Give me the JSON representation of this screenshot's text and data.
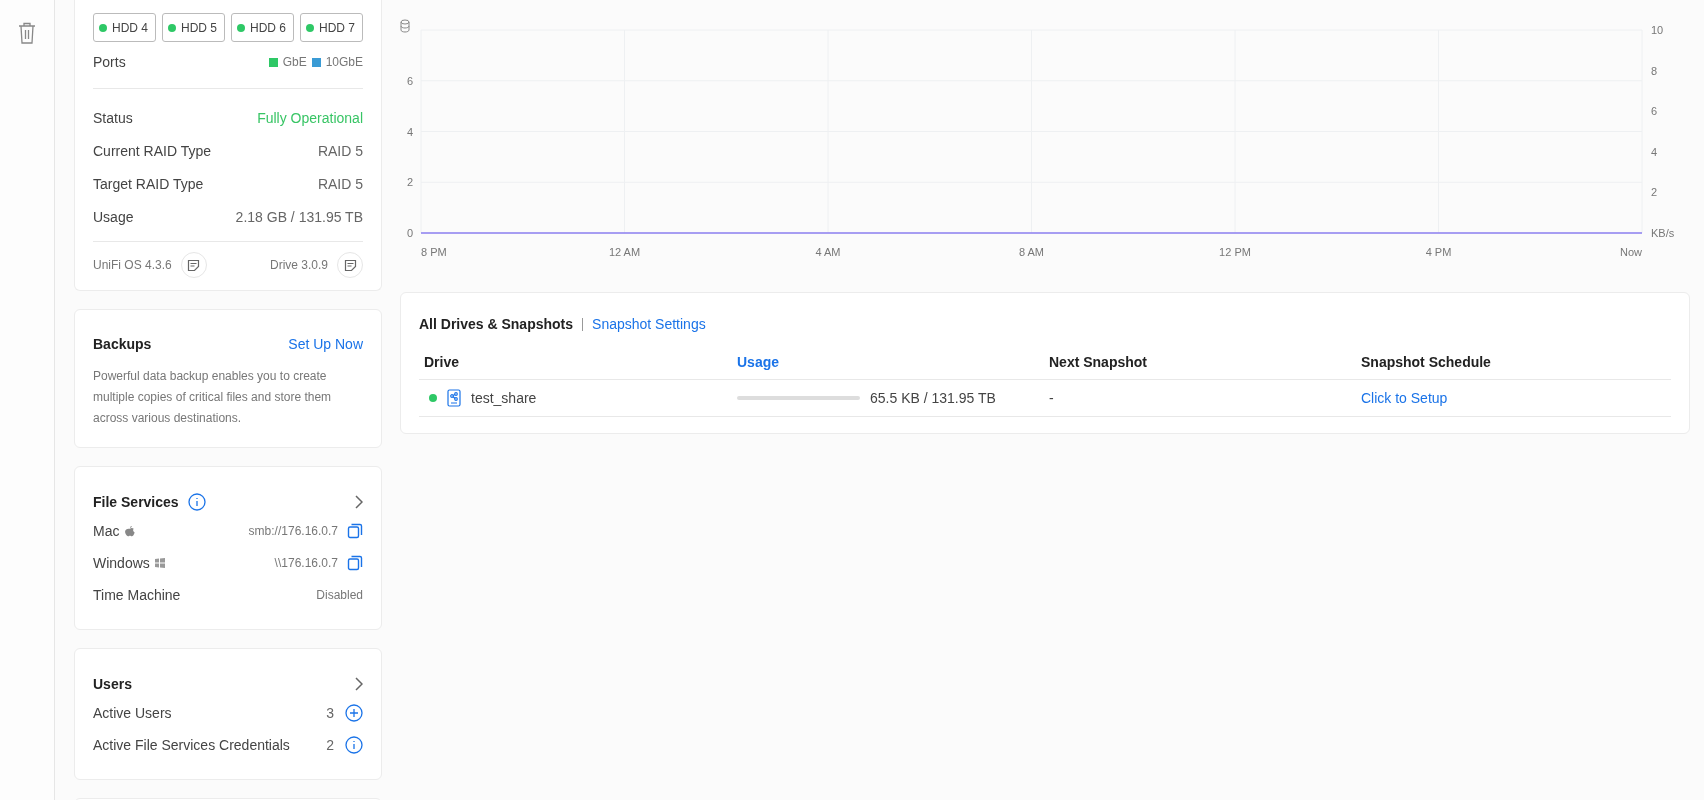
{
  "disks": [
    {
      "label": "HDD 4",
      "healthy": true
    },
    {
      "label": "HDD 5",
      "healthy": true
    },
    {
      "label": "HDD 6",
      "healthy": true
    },
    {
      "label": "HDD 7",
      "healthy": true
    }
  ],
  "ports": {
    "label": "Ports",
    "legend": [
      {
        "label": "GbE",
        "color": "#2ec866"
      },
      {
        "label": "10GbE",
        "color": "#3a9bd5"
      }
    ]
  },
  "details": [
    {
      "label": "Status",
      "value": "Fully Operational",
      "kind": "ok"
    },
    {
      "label": "Current RAID Type",
      "value": "RAID 5",
      "kind": "plain"
    },
    {
      "label": "Target RAID Type",
      "value": "RAID 5",
      "kind": "plain"
    },
    {
      "label": "Usage",
      "value": "2.18 GB / 131.95 TB",
      "kind": "plain"
    }
  ],
  "versions": [
    "UniFi OS 4.3.6",
    "Drive 3.0.9"
  ],
  "backups": {
    "title": "Backups",
    "action": "Set Up Now",
    "description": "Powerful data backup enables you to create multiple copies of critical files and store them across various destinations."
  },
  "file_services": {
    "title": "File Services",
    "rows": [
      {
        "label": "Mac",
        "kind": "mac",
        "value": "smb://176.16.0.7"
      },
      {
        "label": "Windows",
        "kind": "windows",
        "value": "\\\\176.16.0.7"
      },
      {
        "label": "Time Machine",
        "kind": "plain",
        "value": "Disabled"
      }
    ]
  },
  "users": {
    "title": "Users",
    "rows": [
      {
        "label": "Active Users",
        "value": "3",
        "kind": "add"
      },
      {
        "label": "Active File Services Credentials",
        "value": "2",
        "kind": "info"
      }
    ]
  },
  "chart_data": {
    "type": "line",
    "x": [
      "8 PM",
      "12 AM",
      "4 AM",
      "8 AM",
      "12 PM",
      "4 PM",
      "Now"
    ],
    "series": [
      {
        "color": "#8c7ff0",
        "values": [
          0,
          0,
          0,
          0,
          0,
          0,
          0
        ]
      }
    ],
    "ylim": [
      0,
      8
    ],
    "yticks": [
      0,
      2,
      4,
      6
    ],
    "grid": true
  },
  "right_axis": {
    "ticks": [
      "10",
      "8",
      "6",
      "4",
      "2"
    ],
    "unit": "KB/s"
  },
  "drives": {
    "tabs": [
      {
        "label": "All Drives & Snapshots",
        "selected": true
      },
      {
        "label": "Snapshot Settings",
        "selected": false
      }
    ],
    "columns": [
      {
        "label": "Drive",
        "sortable": false
      },
      {
        "label": "Usage",
        "sortable": true
      },
      {
        "label": "Next Snapshot",
        "sortable": false
      },
      {
        "label": "Snapshot Schedule",
        "sortable": false
      }
    ],
    "rows": [
      {
        "name": "test_share",
        "healthy": true,
        "level": 0,
        "usage": "65.5 KB / 131.95 TB",
        "next_snapshot": "-",
        "schedule": "Click to Setup"
      }
    ]
  }
}
